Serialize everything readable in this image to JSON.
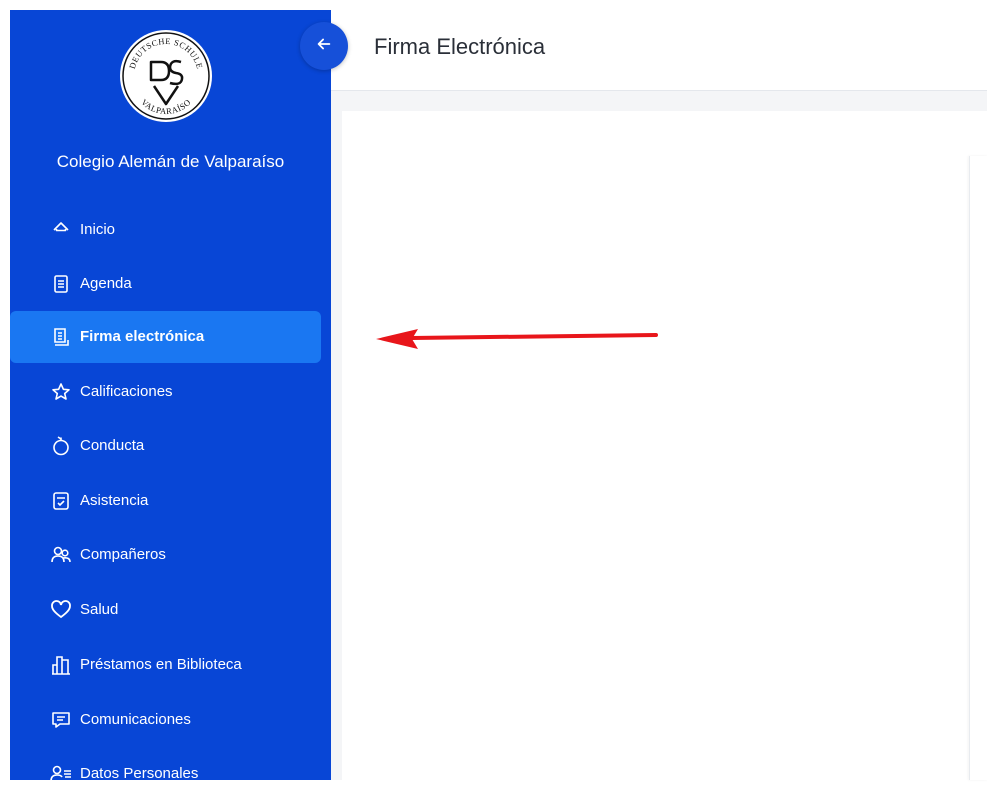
{
  "school": {
    "name": "Colegio Alemán de Valparaíso",
    "logo_text": "DEUTSCHE SCHULE VALPARAÍSO",
    "logo_monogram": "DSV"
  },
  "header": {
    "title": "Firma Electrónica"
  },
  "sidebar": {
    "items": [
      {
        "label": "Inicio",
        "icon": "home-icon"
      },
      {
        "label": "Agenda",
        "icon": "notebook-icon"
      },
      {
        "label": "Firma electrónica",
        "icon": "document-icon",
        "active": true
      },
      {
        "label": "Calificaciones",
        "icon": "star-icon"
      },
      {
        "label": "Conducta",
        "icon": "apple-icon"
      },
      {
        "label": "Asistencia",
        "icon": "checklist-icon"
      },
      {
        "label": "Compañeros",
        "icon": "users-icon"
      },
      {
        "label": "Salud",
        "icon": "heart-icon"
      },
      {
        "label": "Préstamos en Biblioteca",
        "icon": "library-icon"
      },
      {
        "label": "Comunicaciones",
        "icon": "message-icon"
      },
      {
        "label": "Datos Personales",
        "icon": "person-list-icon"
      }
    ]
  },
  "colors": {
    "sidebar": "#0846d6",
    "active_item": "#1a77f2",
    "annotation_arrow": "#e8161b"
  }
}
